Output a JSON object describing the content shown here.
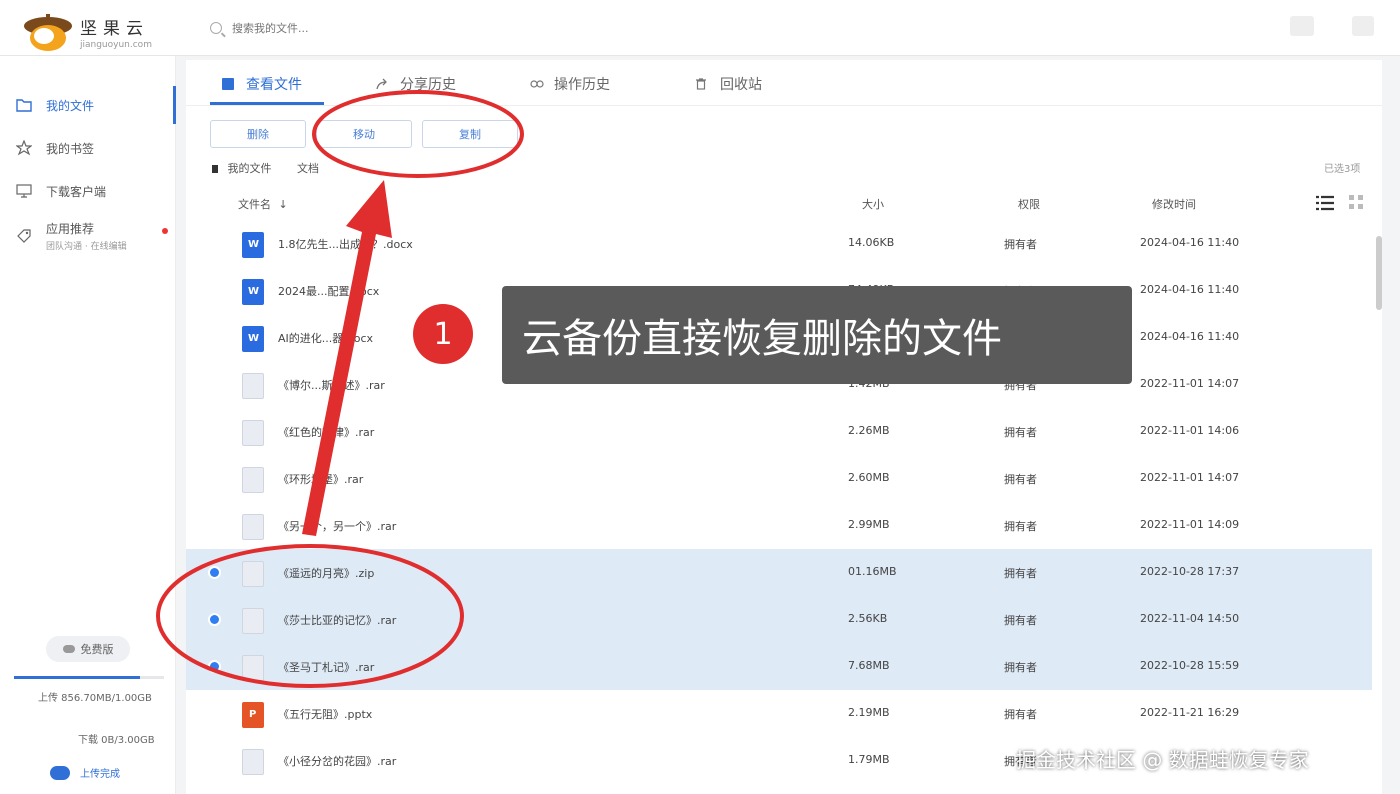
{
  "app": {
    "logo_title": "坚果云",
    "logo_sub": "jianguoyun.com"
  },
  "search": {
    "placeholder": "搜索我的文件..."
  },
  "sidebar": {
    "items": [
      {
        "label": "我的文件",
        "sub": ""
      },
      {
        "label": "我的书签",
        "sub": ""
      },
      {
        "label": "下载客户端",
        "sub": ""
      },
      {
        "label": "应用推荐",
        "sub": "团队沟通 · 在线编辑"
      }
    ],
    "free_label": "免费版",
    "upload_quota": "上传 856.70MB/1.00GB",
    "download_quota": "下载 0B/3.00GB",
    "upload_progress": 0.84,
    "upload_done_label": "上传完成"
  },
  "tabs": [
    {
      "label": "查看文件"
    },
    {
      "label": "分享历史"
    },
    {
      "label": "操作历史"
    },
    {
      "label": "回收站"
    }
  ],
  "actions": {
    "delete_label": "删除",
    "move_label": "移动",
    "copy_label": "复制"
  },
  "breadcrumb": {
    "root": "我的文件",
    "current": "文档"
  },
  "selection_text": "已选3项",
  "columns": {
    "name": "文件名",
    "size": "大小",
    "perm": "权限",
    "time": "修改时间"
  },
  "files": [
    {
      "icon": "word",
      "name": "1.8亿先生...出成名？.docx",
      "size": "14.06KB",
      "perm": "拥有者",
      "time": "2024-04-16 11:40"
    },
    {
      "icon": "word",
      "name": "2024最...配置.docx",
      "size": "74.49KB",
      "perm": "拥有者",
      "time": "2024-04-16 11:40"
    },
    {
      "icon": "word",
      "name": "AI的进化...器.docx",
      "size": "",
      "perm": "拥有者",
      "time": "2024-04-16 11:40"
    },
    {
      "icon": "rar",
      "name": "《博尔...斯口述》.rar",
      "size": "1.42MB",
      "perm": "拥有者",
      "time": "2022-11-01 14:07"
    },
    {
      "icon": "rar",
      "name": "《红色的旋律》.rar",
      "size": "2.26MB",
      "perm": "拥有者",
      "time": "2022-11-01 14:06"
    },
    {
      "icon": "rar",
      "name": "《环形城堡》.rar",
      "size": "2.60MB",
      "perm": "拥有者",
      "time": "2022-11-01 14:07"
    },
    {
      "icon": "rar",
      "name": "《另一个，另一个》.rar",
      "size": "2.99MB",
      "perm": "拥有者",
      "time": "2022-11-01 14:09"
    },
    {
      "icon": "rar",
      "name": "《遥远的月亮》.zip",
      "size": "01.16MB",
      "perm": "拥有者",
      "time": "2022-10-28 17:37",
      "selected": true
    },
    {
      "icon": "rar",
      "name": "《莎士比亚的记忆》.rar",
      "size": "2.56KB",
      "perm": "拥有者",
      "time": "2022-11-04 14:50",
      "selected": true
    },
    {
      "icon": "rar",
      "name": "《圣马丁札记》.rar",
      "size": "7.68MB",
      "perm": "拥有者",
      "time": "2022-10-28 15:59",
      "selected": true
    },
    {
      "icon": "ppt",
      "name": "《五行无阻》.pptx",
      "size": "2.19MB",
      "perm": "拥有者",
      "time": "2022-11-21 16:29"
    },
    {
      "icon": "rar",
      "name": "《小径分岔的花园》.rar",
      "size": "1.79MB",
      "perm": "拥有者",
      "time": ""
    }
  ],
  "annotation": {
    "badge": "1",
    "text": "云备份直接恢复删除的文件",
    "color": "#e02d2d"
  },
  "watermark": "掘金技术社区 @ 数据蛙恢复专家",
  "colors": {
    "accent": "#2f6fd6",
    "selected_row": "#dfeaf7"
  }
}
